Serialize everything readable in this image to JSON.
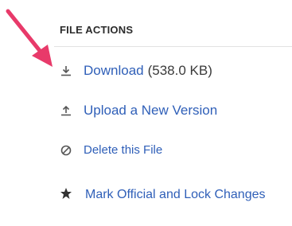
{
  "file_actions": {
    "title": "FILE ACTIONS",
    "download_label": "Download",
    "download_size": "(538.0 KB)",
    "upload_label": "Upload a New Version",
    "delete_label": "Delete this File",
    "mark_label": "Mark Official and Lock Changes"
  },
  "icons": {
    "download": "download-icon",
    "upload": "upload-icon",
    "delete": "prohibit-icon",
    "mark": "star-icon",
    "pointer": "arrow-annotation"
  },
  "colors": {
    "link": "#2f5fb8",
    "annotation_arrow": "#e83a6a"
  }
}
